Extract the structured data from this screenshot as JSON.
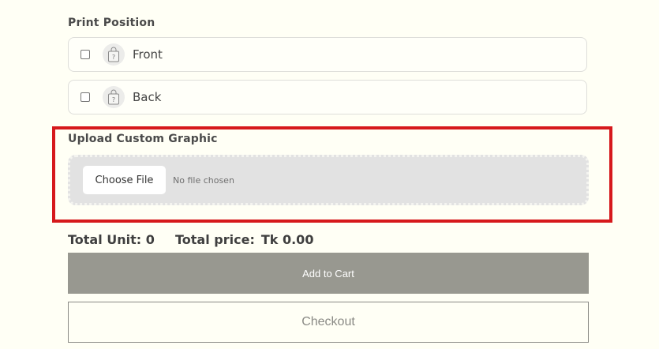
{
  "print_position": {
    "label": "Print Position",
    "options": [
      {
        "label": "Front",
        "checked": false,
        "icon": "bag-placeholder-icon"
      },
      {
        "label": "Back",
        "checked": false,
        "icon": "bag-placeholder-icon"
      }
    ]
  },
  "upload": {
    "label": "Upload Custom Graphic",
    "choose_button_label": "Choose File",
    "status_text": "No file chosen"
  },
  "totals": {
    "unit_label": "Total Unit:",
    "unit_value": "0",
    "price_label": "Total price:",
    "price_value": "Tk 0.00"
  },
  "actions": {
    "add_to_cart_label": "Add to Cart",
    "checkout_label": "Checkout"
  },
  "colors": {
    "highlight": "#d6191c",
    "add_to_cart_bg": "#989890",
    "page_bg": "#fffff5"
  }
}
